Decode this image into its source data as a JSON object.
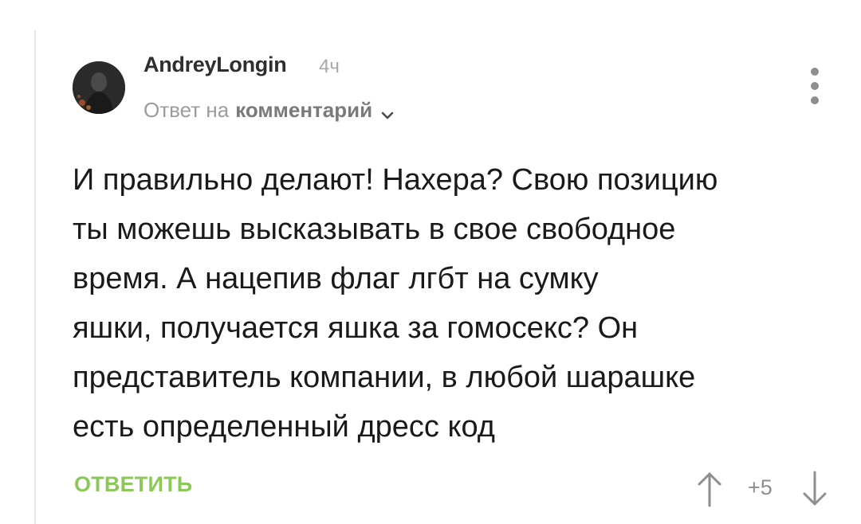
{
  "comment": {
    "author": "AndreyLongin",
    "time": "4ч",
    "reply_prefix": "Ответ на",
    "reply_link": "комментарий",
    "body_lines": [
      "И правильно делают! Нахера? Свою позицию",
      "ты можешь высказывать в свое свободное",
      "время. А нацепив флаг лгбт на сумку",
      "яшки, получается яшка за гомосекс? Он",
      "представитель компании, в любой шарашке",
      "есть определенный дресс код"
    ],
    "reply_button": "ОТВЕТИТЬ",
    "rating": "+5"
  },
  "icons": {
    "avatar": "avatar",
    "chevron": "chevron-down-icon",
    "menu": "more-vertical-icon",
    "upvote": "arrow-up-icon",
    "downvote": "arrow-down-icon"
  },
  "colors": {
    "reply_button": "#8ac858",
    "muted_text": "#9c9c9c",
    "body_text": "#1a1a1a"
  }
}
